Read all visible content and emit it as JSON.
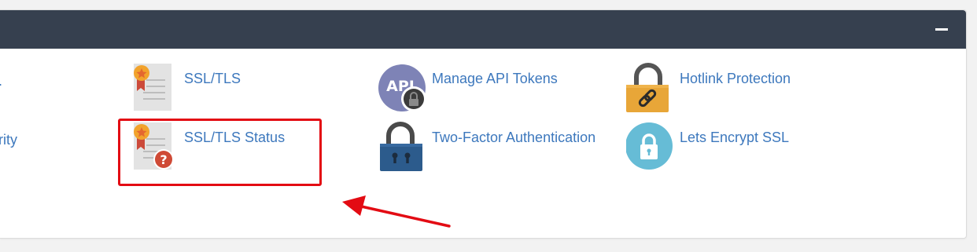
{
  "page": {
    "header": {
      "collapse_icon": "minus-icon"
    },
    "left_cut_labels": [
      ".",
      "rity"
    ],
    "items": [
      {
        "label": "SSL/TLS",
        "icon": "certificate-icon"
      },
      {
        "label": "SSL/TLS Status",
        "icon": "certificate-question-icon"
      },
      {
        "label": "Manage API Tokens",
        "icon": "api-lock-icon"
      },
      {
        "label": "Two-Factor Authentication",
        "icon": "padlock-icon"
      },
      {
        "label": "Hotlink Protection",
        "icon": "chain-lock-icon"
      },
      {
        "label": "Lets Encrypt SSL",
        "icon": "lock-circle-icon"
      }
    ],
    "annotation": {
      "highlight_color": "#e30b13",
      "arrow_color": "#e30b13"
    },
    "colors": {
      "header": "#36404f",
      "link": "#3d78bd",
      "background": "#f2f2f2"
    }
  }
}
